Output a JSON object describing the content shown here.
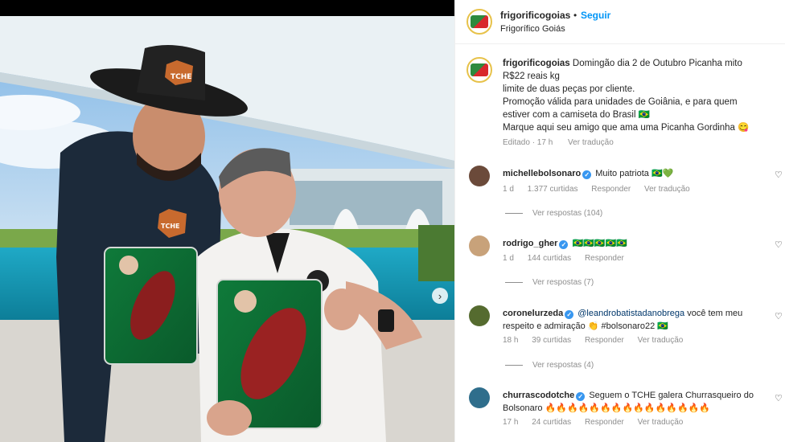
{
  "colors": {
    "link": "#0095f6",
    "verified": "#3897f0",
    "muted": "#8e8e8e",
    "text": "#262626"
  },
  "photo": {
    "alt_icons": [
      "person-hat-icon",
      "person-icon",
      "steak-tray-icon"
    ],
    "next_icon": "chevron-right-icon"
  },
  "header": {
    "username": "frigorificogoias",
    "dot": "•",
    "follow_label": "Seguir",
    "subtitle": "Frigorífico Goiás"
  },
  "caption": {
    "username": "frigorificogoias",
    "lines": [
      "Domingão dia 2 de Outubro Picanha mito",
      "R$22 reais kg",
      "limite de duas peças por cliente.",
      "Promoção válida para unidades de Goiânia, e para quem",
      "estiver com a camiseta do Brasil 🇧🇷",
      "Marque aqui seu amigo que ama uma Picanha Gordinha 😋"
    ],
    "edited": "Editado · 17 h",
    "see_translation": "Ver tradução"
  },
  "comments": [
    {
      "username": "michellebolsonaro",
      "verified": true,
      "text": "Muito patriota 🇧🇷💚",
      "time": "1 d",
      "likes": "1.377 curtidas",
      "reply": "Responder",
      "translate": "Ver tradução",
      "view_replies": "Ver respostas (104)"
    },
    {
      "username": "rodrigo_gher",
      "verified": true,
      "text": "🇧🇷🇧🇷🇧🇷🇧🇷🇧🇷",
      "time": "1 d",
      "likes": "144 curtidas",
      "reply": "Responder",
      "translate": "",
      "view_replies": "Ver respostas (7)"
    },
    {
      "username": "coronelurzeda",
      "verified": true,
      "mention": "@leandrobatistadanobrega",
      "text": "você tem meu respeito e admiração 👏 #bolsonaro22 🇧🇷",
      "time": "18 h",
      "likes": "39 curtidas",
      "reply": "Responder",
      "translate": "Ver tradução",
      "view_replies": "Ver respostas (4)"
    },
    {
      "username": "churrascodotche",
      "verified": true,
      "text": "Seguem o TCHE galera Churrasqueiro do Bolsonaro 🔥🔥🔥🔥🔥🔥🔥🔥🔥🔥🔥🔥🔥🔥🔥",
      "time": "17 h",
      "likes": "24 curtidas",
      "reply": "Responder",
      "translate": "Ver tradução",
      "view_replies": ""
    }
  ]
}
